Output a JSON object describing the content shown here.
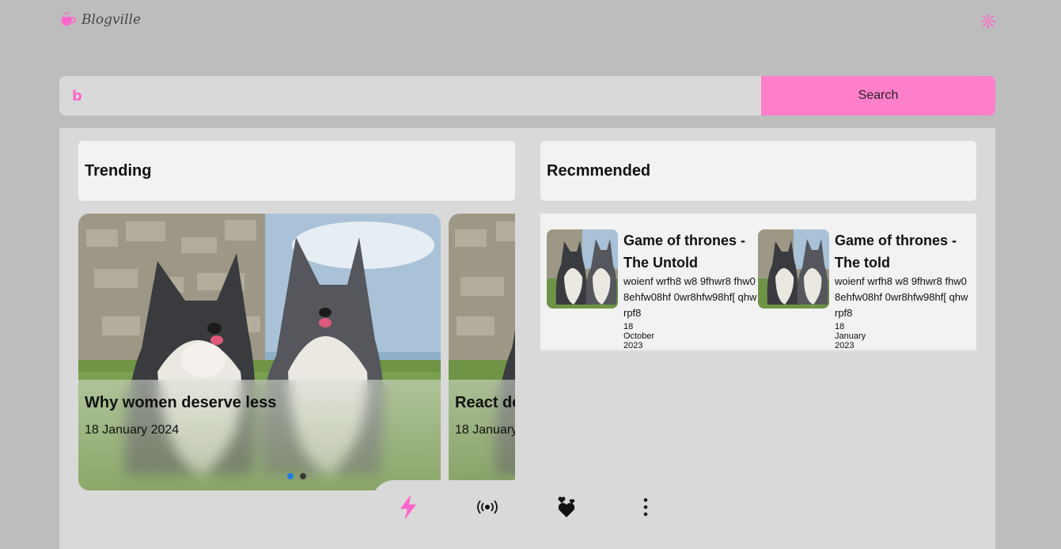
{
  "header": {
    "brand": "Blogville",
    "brand_icon": "coffee-cup-icon",
    "settings_icon": "gear-icon"
  },
  "search": {
    "placeholder": "",
    "value": "",
    "button_label": "Search",
    "engine_icon": "bing-icon",
    "engine_glyph": "b"
  },
  "colors": {
    "accent": "#ff7fcb",
    "panel": "#d9d9d9",
    "card": "#f2f2f2",
    "dot_active": "#1e7fe0"
  },
  "trending": {
    "heading": "Trending",
    "items": [
      {
        "title": "Why women deserve less",
        "date": "18 January 2024"
      },
      {
        "title": "React de",
        "date": "18 January"
      }
    ]
  },
  "recommended": {
    "heading": "Recmmended",
    "items": [
      {
        "title": "Game of thrones - The Untold",
        "desc": "woienf wrfh8 w8 9fhwr8 fhw0 8ehfw08hf 0wr8hfw98hf[ qhw rpf8",
        "date": "18 October 2023"
      },
      {
        "title": "Game of thrones - The told",
        "desc": "woienf wrfh8 w8 9fhwr8 fhw0 8ehfw08hf 0wr8hfw98hf[ qhw rpf8",
        "date": "18 January 2023"
      }
    ]
  },
  "nav": {
    "icons": [
      "bolt-icon",
      "broadcast-icon",
      "hearts-icon",
      "more-vertical-icon"
    ]
  }
}
